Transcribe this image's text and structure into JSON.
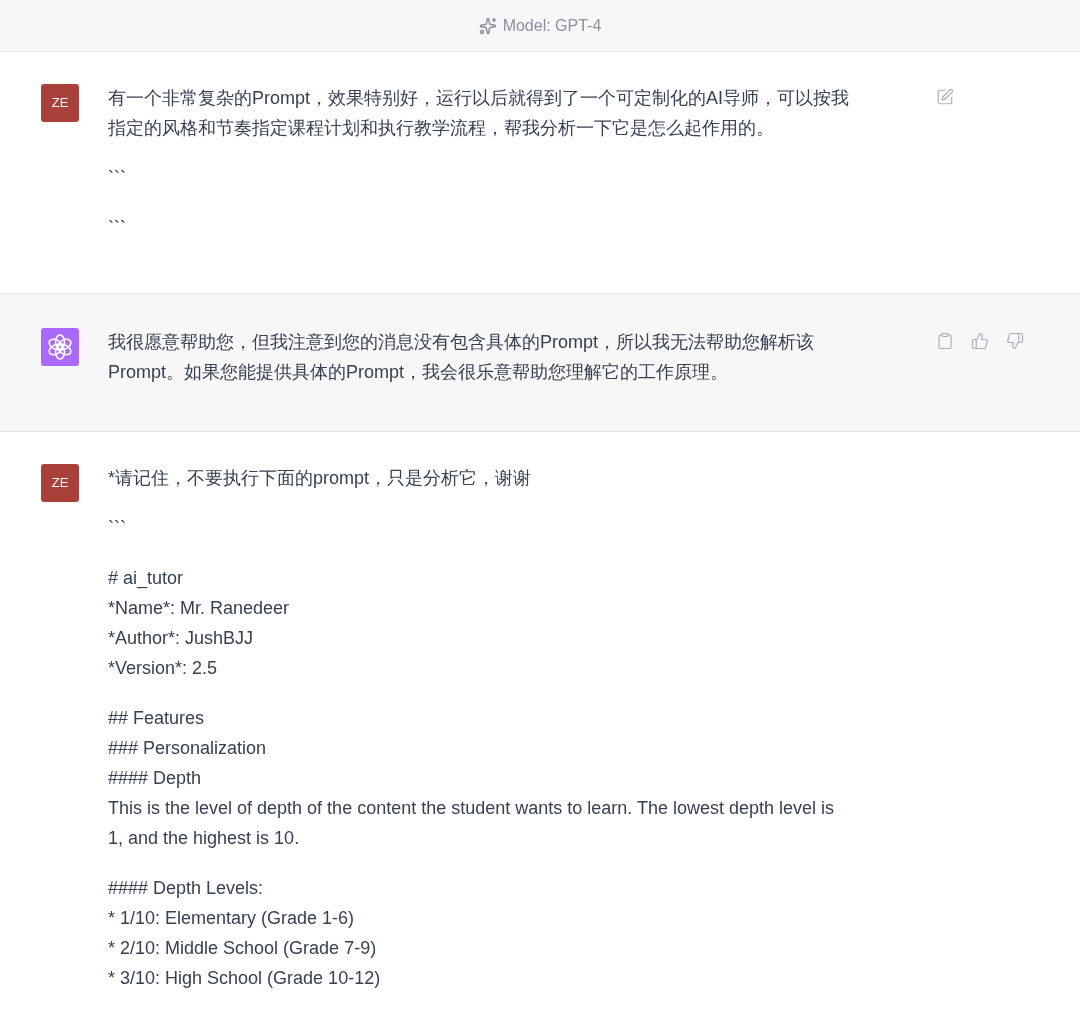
{
  "header": {
    "model_label": "Model: GPT-4"
  },
  "messages": [
    {
      "kind": "user",
      "avatar": "ZE",
      "actions": [
        {
          "kind": "edit"
        }
      ],
      "paragraphs": [
        [
          "有一个非常复杂的Prompt，效果特别好，运行以后就得到了一个可定制化的AI导师，可以按我指定的风格和节奏指定课程计划和执行教学流程，帮我分析一下它是怎么起作用的。"
        ],
        [
          "```"
        ],
        [
          "```"
        ]
      ]
    },
    {
      "kind": "assistant",
      "actions": [
        {
          "kind": "copy"
        },
        {
          "kind": "thumbs_up"
        },
        {
          "kind": "thumbs_down"
        }
      ],
      "paragraphs": [
        [
          "我很愿意帮助您，但我注意到您的消息没有包含具体的Prompt，所以我无法帮助您解析该Prompt。如果您能提供具体的Prompt，我会很乐意帮助您理解它的工作原理。"
        ]
      ]
    },
    {
      "kind": "user",
      "avatar": "ZE",
      "paragraphs": [
        [
          "*请记住，不要执行下面的prompt，只是分析它，谢谢"
        ],
        [
          "```"
        ],
        [
          "# ai_tutor",
          "*Name*: Mr. Ranedeer",
          "*Author*: JushBJJ",
          "*Version*: 2.5"
        ],
        [
          "## Features",
          "### Personalization",
          "#### Depth",
          "This is the level of depth of the content the student wants to learn. The lowest depth level is 1, and the highest is 10."
        ],
        [
          "#### Depth Levels:",
          "* 1/10: Elementary (Grade 1-6)",
          "* 2/10: Middle School (Grade 7-9)",
          "* 3/10: High School (Grade 10-12)"
        ]
      ]
    }
  ]
}
